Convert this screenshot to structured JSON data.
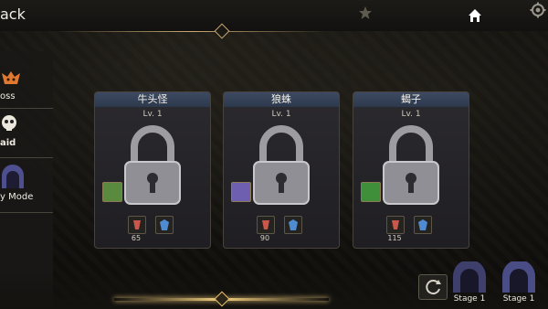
{
  "header": {
    "back_label": "ack"
  },
  "sidebar": {
    "items": [
      {
        "label": "oss",
        "icon": "boss-icon"
      },
      {
        "label": "aid",
        "icon": "skull-icon"
      },
      {
        "label": "y Mode",
        "icon": "gate-icon"
      }
    ]
  },
  "cards": [
    {
      "name": "牛头怪",
      "level": "Lv. 1",
      "attr1": "65",
      "attr2": "",
      "skill_color": "#5a8a3e",
      "skill_icon": "green-skill-icon"
    },
    {
      "name": "狼蛛",
      "level": "Lv. 1",
      "attr1": "90",
      "attr2": "",
      "skill_color": "#6e5fb0",
      "skill_icon": "purple-skill-icon"
    },
    {
      "name": "蝎子",
      "level": "Lv. 1",
      "attr1": "115",
      "attr2": "",
      "skill_color": "#3f8f3a",
      "skill_icon": "green-ring-skill-icon"
    }
  ],
  "bottom": {
    "stages": [
      {
        "label": "Stage 1"
      },
      {
        "label": "Stage 1"
      }
    ]
  },
  "colors": {
    "accent_gold": "#c9ab73",
    "title_blue": "#3d4a61"
  }
}
